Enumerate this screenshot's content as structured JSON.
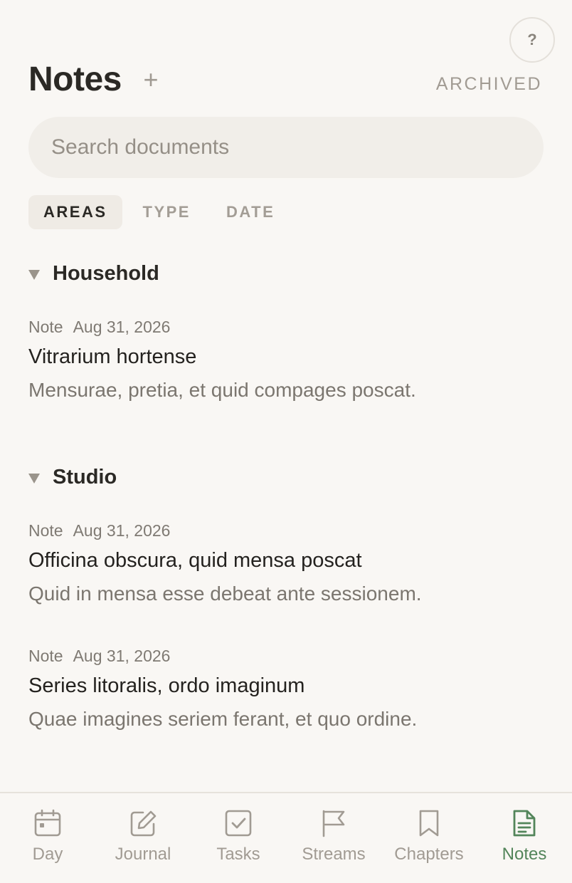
{
  "header": {
    "title": "Notes",
    "add_label": "+",
    "archived_label": "ARCHIVED",
    "help_label": "?"
  },
  "search": {
    "placeholder": "Search documents",
    "value": ""
  },
  "filters": [
    {
      "label": "AREAS",
      "active": true
    },
    {
      "label": "TYPE",
      "active": false
    },
    {
      "label": "DATE",
      "active": false
    }
  ],
  "groups": [
    {
      "title": "Household",
      "docs": [
        {
          "type": "Note",
          "date": "Aug 31, 2026",
          "title": "Vitrarium hortense",
          "excerpt": "Mensurae, pretia, et quid compages poscat."
        }
      ]
    },
    {
      "title": "Studio",
      "docs": [
        {
          "type": "Note",
          "date": "Aug 31, 2026",
          "title": "Officina obscura, quid mensa poscat",
          "excerpt": "Quid in mensa esse debeat ante sessionem."
        },
        {
          "type": "Note",
          "date": "Aug 31, 2026",
          "title": "Series litoralis, ordo imaginum",
          "excerpt": "Quae imagines seriem ferant, et quo ordine."
        }
      ]
    }
  ],
  "tabbar": [
    {
      "label": "Day",
      "icon": "calendar-icon",
      "active": false
    },
    {
      "label": "Journal",
      "icon": "edit-icon",
      "active": false
    },
    {
      "label": "Tasks",
      "icon": "checkbox-icon",
      "active": false
    },
    {
      "label": "Streams",
      "icon": "flag-icon",
      "active": false
    },
    {
      "label": "Chapters",
      "icon": "bookmark-icon",
      "active": false
    },
    {
      "label": "Notes",
      "icon": "document-icon",
      "active": true
    }
  ],
  "colors": {
    "background": "#f9f7f4",
    "accent": "#53855a",
    "muted": "#a19b93",
    "search_bg": "#f1eee9"
  }
}
